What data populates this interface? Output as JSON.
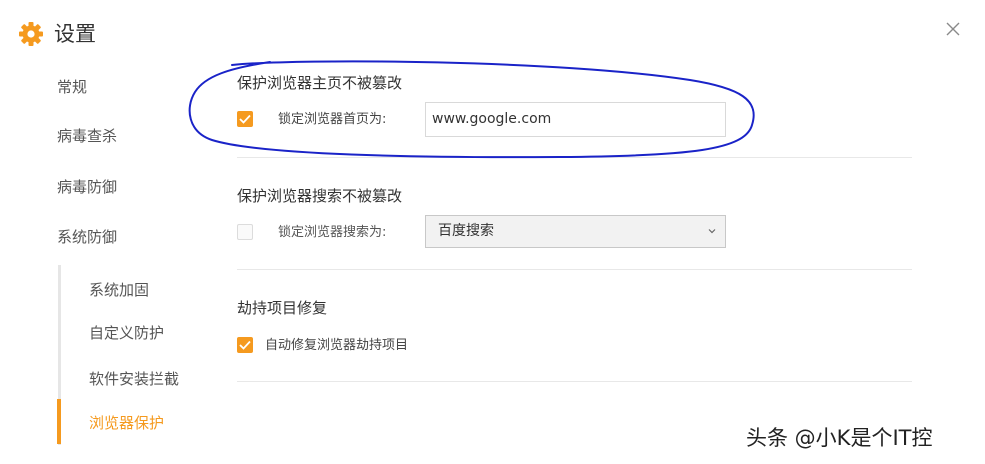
{
  "header": {
    "title": "设置",
    "gear_icon": "gear-icon",
    "close_icon": "close-icon"
  },
  "colors": {
    "accent": "#f59a1f",
    "annotation": "#1a23c8"
  },
  "sidebar": {
    "items": [
      "常规",
      "病毒查杀",
      "病毒防御",
      "系统防御"
    ],
    "sub_items": [
      "系统加固",
      "自定义防护",
      "软件安装拦截",
      "浏览器保护"
    ],
    "active": "浏览器保护"
  },
  "sections": {
    "homepage": {
      "title": "保护浏览器主页不被篡改",
      "checkbox_label": "锁定浏览器首页为:",
      "checked": true,
      "value": "www.google.com"
    },
    "search": {
      "title": "保护浏览器搜索不被篡改",
      "checkbox_label": "锁定浏览器搜索为:",
      "checked": false,
      "selected": "百度搜索"
    },
    "hijack": {
      "title": "劫持项目修复",
      "checkbox_label": "自动修复浏览器劫持项目",
      "checked": true
    }
  },
  "watermark": "头条 @小K是个IT控"
}
